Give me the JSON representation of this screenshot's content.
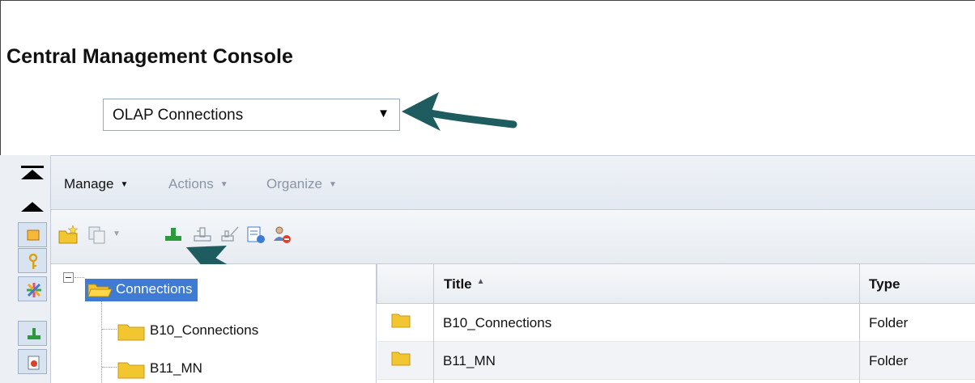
{
  "app": {
    "title": "Central Management Console"
  },
  "view_select": {
    "value": "OLAP Connections",
    "caret": "▼"
  },
  "menu": {
    "manage": "Manage",
    "actions": "Actions",
    "organize": "Organize",
    "caret": "▼"
  },
  "toolbar": {
    "icons": [
      "new-folder-icon",
      "copy-icon",
      "new-connection-icon",
      "connection-icon",
      "edit-connection-icon",
      "properties-icon",
      "user-security-icon"
    ]
  },
  "rail": {
    "icons": [
      "collapse-all-icon",
      "collapse-icon",
      "key-icon",
      "categories-icon",
      "connection-icon",
      "document-icon"
    ]
  },
  "tree": {
    "root": "Connections",
    "children": [
      "B10_Connections",
      "B11_MN"
    ]
  },
  "grid": {
    "columns": [
      "Title",
      "Type"
    ],
    "rows": [
      {
        "title": "B10_Connections",
        "type": "Folder"
      },
      {
        "title": "B11_MN",
        "type": "Folder"
      }
    ]
  },
  "colors": {
    "accent": "#3d7bd5",
    "arrow": "#1f5c60",
    "folder": "#f2c631"
  }
}
